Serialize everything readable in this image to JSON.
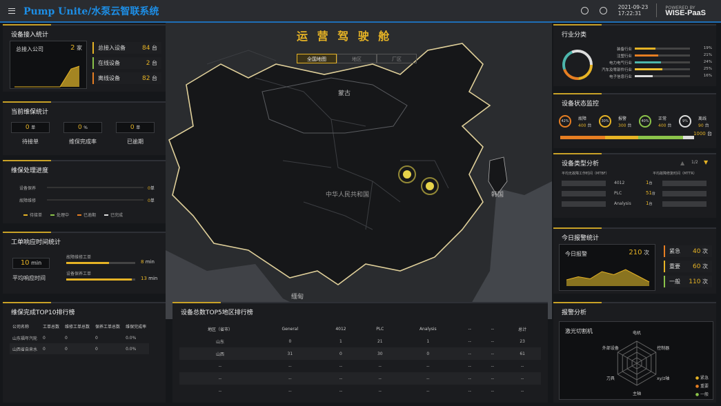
{
  "header": {
    "title": "Pump Unite/水泵云智联系统",
    "date": "2021-09-23",
    "time": "17:22:31",
    "powered": "POWERED BY",
    "brand": "WISE-PaaS"
  },
  "map": {
    "title": "运 营 驾 驶 舱",
    "tabs": [
      "全国地图",
      "地区",
      "厂区"
    ],
    "labels": {
      "mongolia": "蒙古",
      "china": "中华人民共和国",
      "korea": "韩国",
      "myanmar": "缅甸"
    }
  },
  "access": {
    "title": "设备接入统计",
    "company_label": "总接入公司",
    "company_value": "2",
    "company_unit": "家",
    "rows": [
      {
        "label": "总接入设备",
        "value": "84",
        "unit": "台",
        "color": "#e6b325"
      },
      {
        "label": "在线设备",
        "value": "2",
        "unit": "台",
        "color": "#8bc34a"
      },
      {
        "label": "离线设备",
        "value": "82",
        "unit": "台",
        "color": "#e67e22"
      }
    ]
  },
  "maint": {
    "title": "当前维保统计",
    "items": [
      {
        "value": "0",
        "unit": "单",
        "label": "待接单"
      },
      {
        "value": "0",
        "unit": "%",
        "label": "维保完成率"
      },
      {
        "value": "0",
        "unit": "单",
        "label": "已逾期"
      }
    ]
  },
  "progress": {
    "title": "维保处理进度",
    "rows": [
      {
        "label": "设备保养",
        "value": "0",
        "unit": "单"
      },
      {
        "label": "故障维修",
        "value": "0",
        "unit": "单"
      }
    ],
    "legend": [
      {
        "label": "待接单",
        "color": "#e6b325"
      },
      {
        "label": "处理中",
        "color": "#8bc34a"
      },
      {
        "label": "已逾期",
        "color": "#e67e22"
      },
      {
        "label": "已完成",
        "color": "#ddd"
      }
    ]
  },
  "response": {
    "title": "工单响应时间统计",
    "avg_value": "10",
    "avg_unit": "min",
    "avg_label": "平均响应时间",
    "bars": [
      {
        "label": "故障维修工单",
        "value": "8",
        "unit": "min",
        "fill": 0.62
      },
      {
        "label": "设备保养工单",
        "value": "13",
        "unit": "min",
        "fill": 0.95
      }
    ]
  },
  "top10": {
    "title": "维保完成TOP10排行榜",
    "headers": [
      "公司名称",
      "工单总数",
      "维修工单总数",
      "保养工单总数",
      "维保完成率"
    ],
    "rows": [
      [
        "山东福年汽轮",
        "0",
        "0",
        "0",
        "0.0%"
      ],
      [
        "山西省自来水",
        "0",
        "0",
        "0",
        "0.0%"
      ]
    ]
  },
  "top5": {
    "title": "设备总数TOP5地区排行榜",
    "headers": [
      "地区（省市）",
      "General",
      "4012",
      "PLC",
      "Analysis",
      "--",
      "--",
      "总计"
    ],
    "rows": [
      [
        "山东",
        "0",
        "1",
        "21",
        "1",
        "--",
        "--",
        "23"
      ],
      [
        "山西",
        "31",
        "0",
        "30",
        "0",
        "--",
        "--",
        "61"
      ],
      [
        "--",
        "--",
        "--",
        "--",
        "--",
        "--",
        "--",
        "--"
      ],
      [
        "--",
        "--",
        "--",
        "--",
        "--",
        "--",
        "--",
        "--"
      ],
      [
        "--",
        "--",
        "--",
        "--",
        "--",
        "--",
        "--",
        "--"
      ]
    ]
  },
  "industry": {
    "title": "行业分类",
    "rows": [
      {
        "label": "装备行业",
        "pct": "19%",
        "fill": 0.19,
        "color": "#e6b325"
      },
      {
        "label": "注塑行业",
        "pct": "21%",
        "fill": 0.21,
        "color": "#e67e22"
      },
      {
        "label": "电力电气行业",
        "pct": "24%",
        "fill": 0.24,
        "color": "#4db6ac"
      },
      {
        "label": "汽车及零部件行业",
        "pct": "25%",
        "fill": 0.25,
        "color": "#f1c232"
      },
      {
        "label": "电子信息行业",
        "pct": "16%",
        "fill": 0.16,
        "color": "#ddd"
      }
    ]
  },
  "status": {
    "title": "设备状态监控",
    "items": [
      {
        "pct": "42%",
        "label": "故障",
        "value": "400",
        "unit": "台",
        "color": "#e67e22"
      },
      {
        "pct": "30%",
        "label": "报警",
        "value": "300",
        "unit": "台",
        "color": "#e6b325"
      },
      {
        "pct": "40%",
        "label": "正常",
        "value": "400",
        "unit": "台",
        "color": "#8bc34a"
      },
      {
        "pct": "9%",
        "label": "离线",
        "value": "90",
        "unit": "台",
        "color": "#ddd"
      }
    ],
    "total": "1000",
    "total_unit": "台"
  },
  "devtype": {
    "title": "设备类型分析",
    "page": "1/2",
    "col1": "平均无故障工作时间（MTBF）",
    "col2": "平均故障修复时间（MTTR）",
    "rows": [
      {
        "name": "4012",
        "value": "1",
        "unit": "台"
      },
      {
        "name": "PLC",
        "value": "51",
        "unit": "台"
      },
      {
        "name": "Analysis",
        "value": "1",
        "unit": "台"
      }
    ]
  },
  "alarm": {
    "title": "今日报警统计",
    "today_label": "今日报警",
    "today_value": "210",
    "today_unit": "次",
    "rows": [
      {
        "label": "紧急",
        "value": "40",
        "unit": "次",
        "color": "#e67e22"
      },
      {
        "label": "重要",
        "value": "60",
        "unit": "次",
        "color": "#e6b325"
      },
      {
        "label": "一般",
        "value": "110",
        "unit": "次",
        "color": "#8bc34a"
      }
    ],
    "trend": [
      0.3,
      0.45,
      0.35,
      0.7,
      0.55,
      0.8,
      0.5,
      0.2
    ]
  },
  "alarmAnalysis": {
    "title": "报警分析",
    "machine": "激光切割机",
    "axes": [
      "电机",
      "控制器",
      "xy/z轴",
      "主轴",
      "刀具",
      "外部设备"
    ],
    "legend": [
      {
        "label": "紧急",
        "color": "#e6b325"
      },
      {
        "label": "重要",
        "color": "#e67e22"
      },
      {
        "label": "一般",
        "color": "#8bc34a"
      }
    ]
  }
}
